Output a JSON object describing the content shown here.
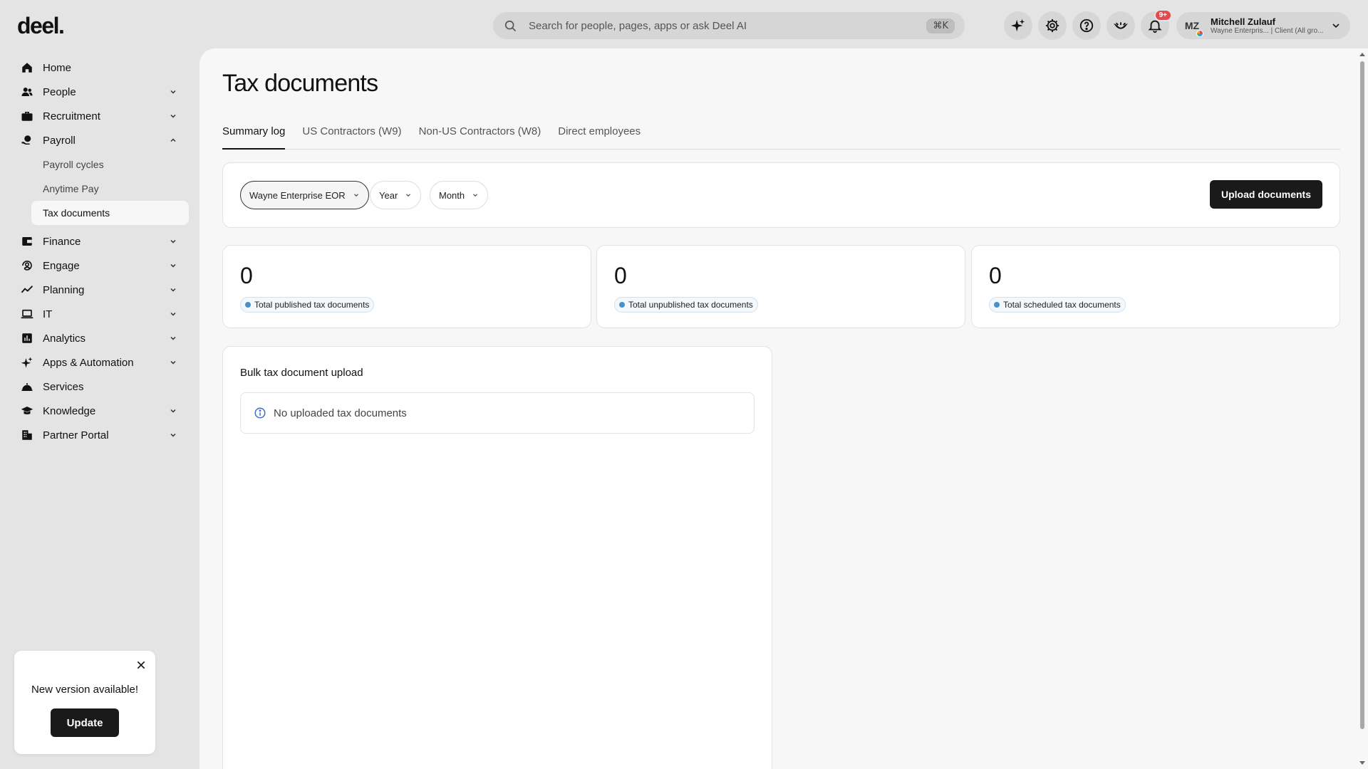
{
  "brand": {
    "logo": "deel."
  },
  "search": {
    "placeholder": "Search for people, pages, apps or ask Deel AI",
    "shortcut": "⌘K"
  },
  "topbar": {
    "icons": [
      "ai-sparkle-icon",
      "gear-icon",
      "help-icon",
      "eye-icon",
      "bell-icon"
    ],
    "notifications_badge": "9+"
  },
  "user": {
    "initials": "MZ",
    "name": "Mitchell Zulauf",
    "subtitle": "Wayne Enterpris... | Client (All gro..."
  },
  "sidebar": {
    "items": [
      {
        "label": "Home",
        "icon": "home-icon",
        "expandable": false
      },
      {
        "label": "People",
        "icon": "people-icon",
        "expandable": true
      },
      {
        "label": "Recruitment",
        "icon": "briefcase-icon",
        "expandable": true
      },
      {
        "label": "Payroll",
        "icon": "payroll-icon",
        "expandable": true,
        "expanded": true,
        "children": [
          {
            "label": "Payroll cycles"
          },
          {
            "label": "Anytime Pay"
          },
          {
            "label": "Tax documents",
            "active": true
          }
        ]
      },
      {
        "label": "Finance",
        "icon": "finance-icon",
        "expandable": true
      },
      {
        "label": "Engage",
        "icon": "engage-icon",
        "expandable": true
      },
      {
        "label": "Planning",
        "icon": "trend-icon",
        "expandable": true
      },
      {
        "label": "IT",
        "icon": "laptop-icon",
        "expandable": true
      },
      {
        "label": "Analytics",
        "icon": "analytics-icon",
        "expandable": true
      },
      {
        "label": "Apps & Automation",
        "icon": "sparkle-icon",
        "expandable": true
      },
      {
        "label": "Services",
        "icon": "services-icon",
        "expandable": false
      },
      {
        "label": "Knowledge",
        "icon": "graduation-icon",
        "expandable": true
      },
      {
        "label": "Partner Portal",
        "icon": "building-icon",
        "expandable": true
      }
    ]
  },
  "page": {
    "title": "Tax documents",
    "tabs": [
      {
        "label": "Summary log",
        "active": true
      },
      {
        "label": "US Contractors (W9)"
      },
      {
        "label": "Non-US Contractors (W8)"
      },
      {
        "label": "Direct employees"
      }
    ],
    "filters": {
      "entity": "Wayne Enterprise EOR",
      "year": "Year",
      "month": "Month",
      "upload_button": "Upload documents"
    },
    "stats": [
      {
        "value": "0",
        "label": "Total published tax documents"
      },
      {
        "value": "0",
        "label": "Total unpublished tax documents"
      },
      {
        "value": "0",
        "label": "Total scheduled tax documents"
      }
    ],
    "bulk": {
      "title": "Bulk tax document upload",
      "empty_message": "No uploaded tax documents"
    }
  },
  "toast": {
    "message": "New version available!",
    "button": "Update"
  },
  "colors": {
    "accent_dark": "#1a1a1a",
    "badge_dot": "#4a90c9",
    "notification": "#e5484d",
    "info_icon": "#3a6fc4"
  }
}
